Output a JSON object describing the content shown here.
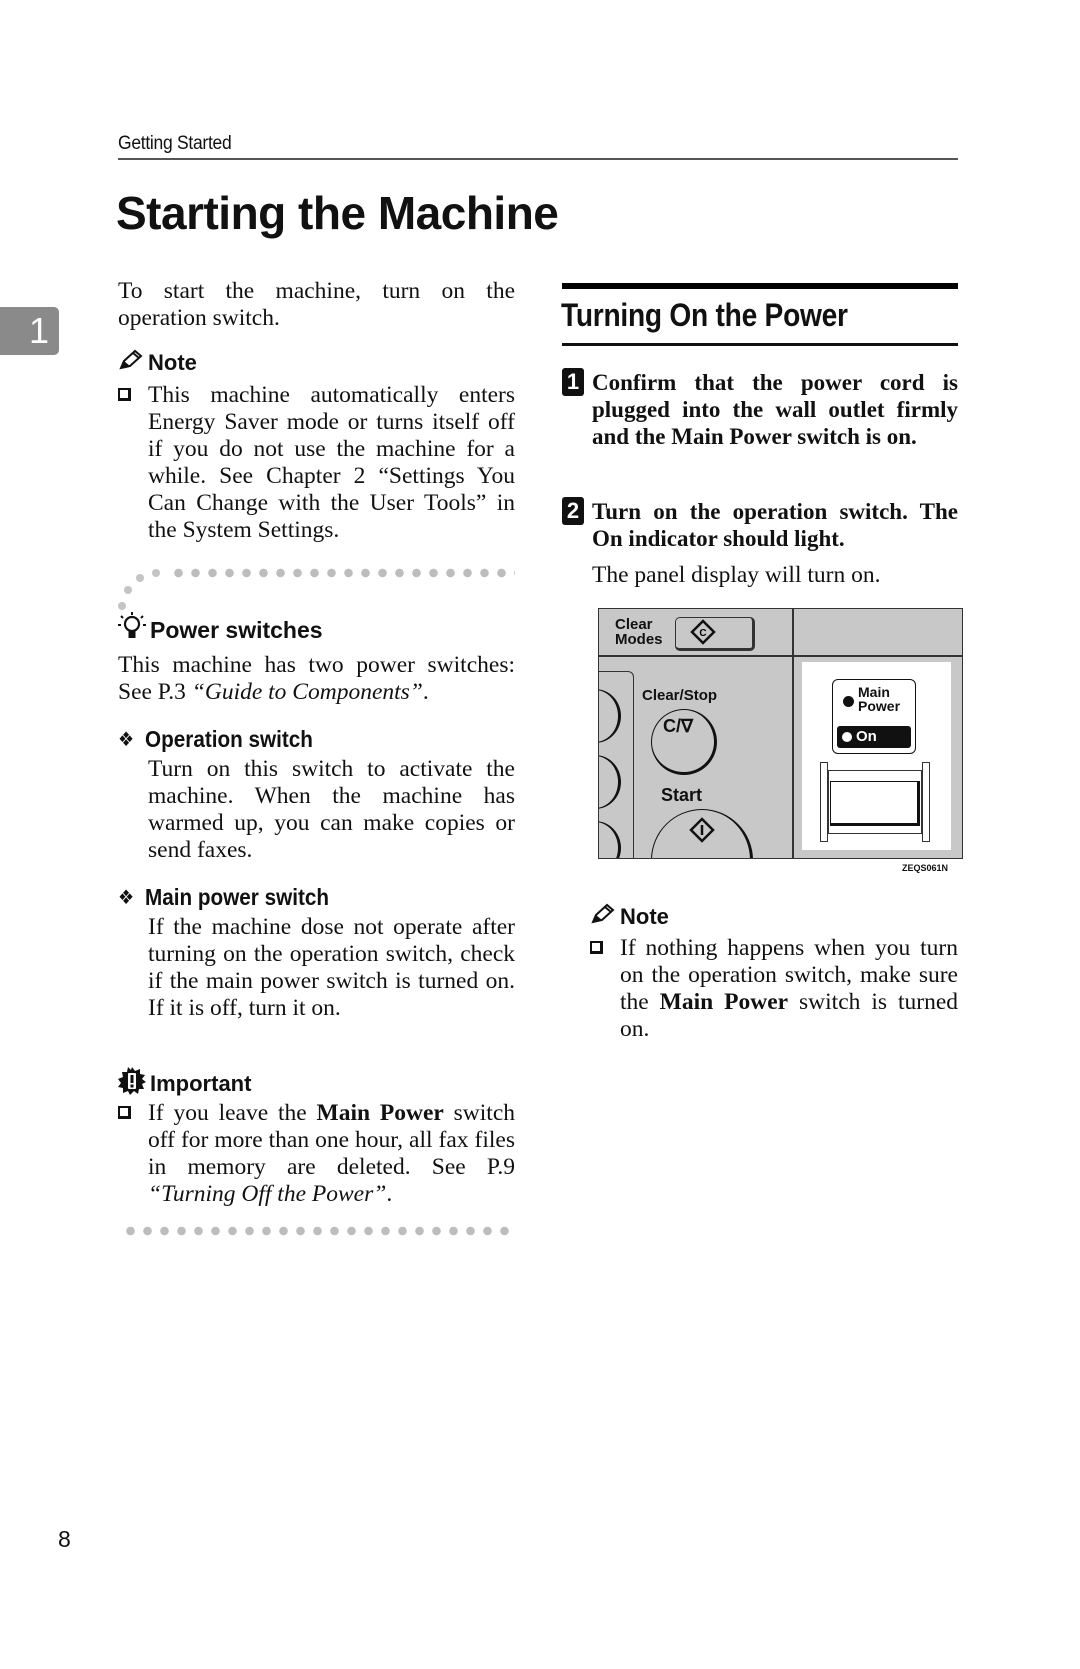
{
  "header": {
    "running_title": "Getting Started"
  },
  "page_title": "Starting the Machine",
  "chapter_tab": "1",
  "intro": "To start the machine, turn on the operation switch.",
  "left_note": {
    "heading": "Note",
    "icon": "pencil-icon",
    "items": [
      "This machine automatically enters Energy Saver mode or turns itself off if you do not use the machine for a while. See Chapter 2 “Settings You Can Change with the User Tools” in the System Settings."
    ]
  },
  "reference": {
    "heading": "Power switches",
    "icon": "lightbulb-icon",
    "intro_prefix": "This machine has two power switches: See P.3 ",
    "intro_link": "“Guide to Components”",
    "intro_suffix": ".",
    "subsections": [
      {
        "title": "Operation switch",
        "text": "Turn on this switch to activate the machine. When the machine has warmed up, you can make copies or send faxes."
      },
      {
        "title": "Main power switch",
        "text": "If the machine dose not operate after turning on the operation switch, check if the main power switch is turned on. If it is off, turn it on."
      }
    ],
    "important": {
      "heading": "Important",
      "icon": "important-icon",
      "prefix": "If you leave the ",
      "bold": "Main Power",
      "middle": " switch off for more than one hour, all fax files in memory are deleted. See P.9 ",
      "link": "“Turning Off the Power”",
      "suffix": "."
    }
  },
  "section": {
    "title": "Turning On the Power",
    "steps": [
      {
        "number": "1",
        "text": "Confirm that the power cord is plugged into the wall outlet firmly and the Main Power switch is on."
      },
      {
        "number": "2",
        "text": "Turn on the operation switch. The On indicator should light.",
        "result": "The panel display will turn on."
      }
    ],
    "diagram": {
      "clear_modes_label": "Clear Modes",
      "clear_stop_label": "Clear/Stop",
      "clear_stop_glyph": "C/∇",
      "start_label": "Start",
      "main_power_label": "Main Power",
      "on_label": "On",
      "figure_id": "ZEQS061N"
    },
    "note": {
      "heading": "Note",
      "icon": "pencil-icon",
      "prefix": "If nothing happens when you turn on the operation switch, make sure the ",
      "bold": "Main Power",
      "suffix": " switch is turned on."
    }
  },
  "page_number": "8"
}
